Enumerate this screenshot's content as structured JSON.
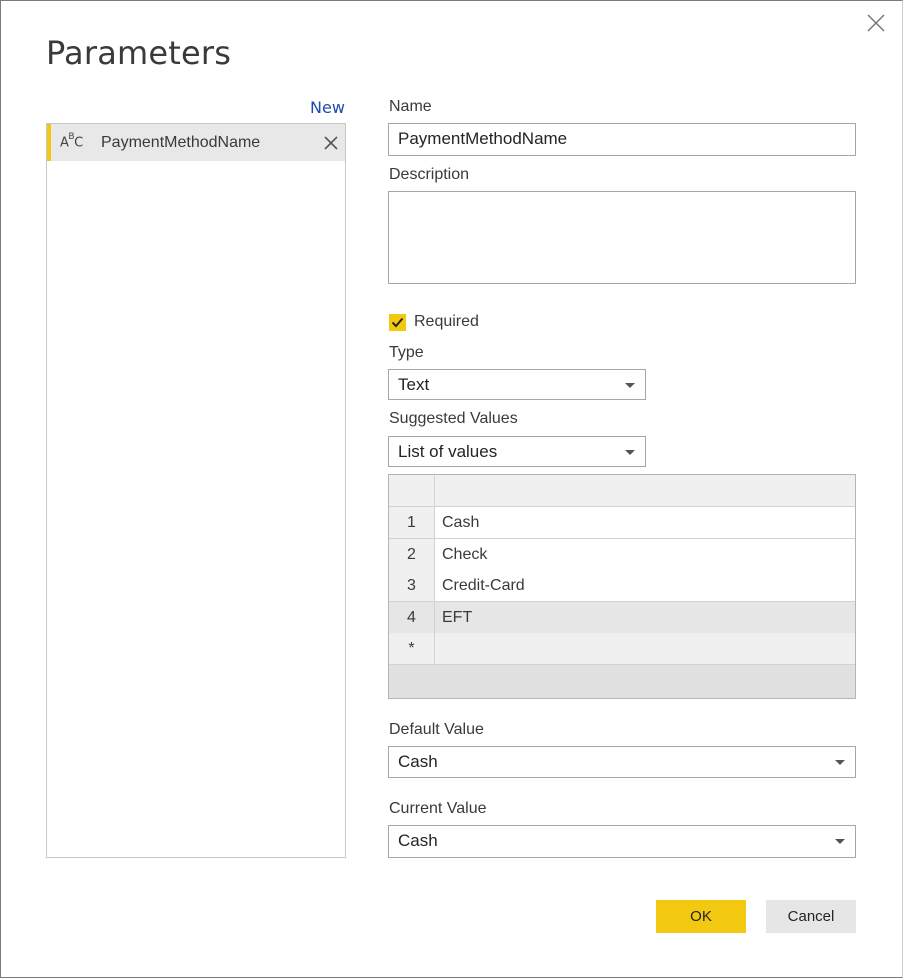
{
  "dialog": {
    "title": "Parameters",
    "new_link": "New",
    "close_icon": "close-icon"
  },
  "parameters": [
    {
      "type_icon": "text-type-icon",
      "type_glyph_a": "A",
      "type_glyph_b": "B",
      "type_glyph_c": "C",
      "name": "PaymentMethodName",
      "delete_icon": "delete-icon"
    }
  ],
  "form": {
    "name_label": "Name",
    "name_value": "PaymentMethodName",
    "description_label": "Description",
    "description_value": "",
    "required_label": "Required",
    "required_checked": true,
    "type_label": "Type",
    "type_value": "Text",
    "suggested_label": "Suggested Values",
    "suggested_value": "List of values",
    "values_rows": [
      {
        "num": "1",
        "value": "Cash"
      },
      {
        "num": "2",
        "value": "Check"
      },
      {
        "num": "3",
        "value": "Credit-Card"
      },
      {
        "num": "4",
        "value": "EFT"
      },
      {
        "num": "*",
        "value": ""
      }
    ],
    "default_label": "Default Value",
    "default_value": "Cash",
    "current_label": "Current Value",
    "current_value": "Cash"
  },
  "buttons": {
    "ok": "OK",
    "cancel": "Cancel"
  },
  "colors": {
    "accent": "#f2c811",
    "link": "#1f4aa8"
  }
}
